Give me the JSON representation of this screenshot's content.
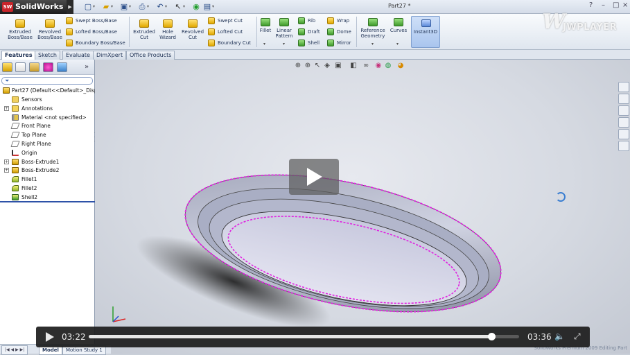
{
  "titlebar": {
    "app_name": "SolidWorks",
    "logo_mark": "SW",
    "document_title": "Part27 *",
    "quick_access_icons": [
      "new-icon",
      "open-icon",
      "save-icon",
      "print-icon",
      "undo-icon",
      "select-icon",
      "rebuild-icon",
      "options-icon"
    ],
    "window_controls": [
      "?",
      "–",
      "□",
      "×"
    ]
  },
  "watermark": {
    "mark": "W",
    "text": "JWPLAYER"
  },
  "ribbon": {
    "extruded_boss": "Extruded\nBoss/Base",
    "revolved_boss": "Revolved\nBoss/Base",
    "swept_boss": "Swept Boss/Base",
    "lofted_boss": "Lofted Boss/Base",
    "boundary_boss": "Boundary Boss/Base",
    "extruded_cut": "Extruded\nCut",
    "hole_wizard": "Hole\nWizard",
    "revolved_cut": "Revolved\nCut",
    "swept_cut": "Swept Cut",
    "lofted_cut": "Lofted Cut",
    "boundary_cut": "Boundary Cut",
    "fillet": "Fillet",
    "linear_pattern": "Linear\nPattern",
    "rib": "Rib",
    "draft": "Draft",
    "shell": "Shell",
    "wrap": "Wrap",
    "dome": "Dome",
    "mirror": "Mirror",
    "reference_geometry": "Reference\nGeometry",
    "curves": "Curves",
    "instant3d": "Instant3D"
  },
  "tabs": [
    "Features",
    "Sketch",
    "Evaluate",
    "DimXpert",
    "Office Products"
  ],
  "feature_tree": {
    "root": "Part27  (Default<<Default>_Displ",
    "items": [
      {
        "label": "Sensors",
        "icon": "sensor",
        "expandable": false
      },
      {
        "label": "Annotations",
        "icon": "anno",
        "expandable": true
      },
      {
        "label": "Material <not specified>",
        "icon": "mat",
        "expandable": false
      },
      {
        "label": "Front Plane",
        "icon": "plane",
        "expandable": false
      },
      {
        "label": "Top Plane",
        "icon": "plane",
        "expandable": false
      },
      {
        "label": "Right Plane",
        "icon": "plane",
        "expandable": false
      },
      {
        "label": "Origin",
        "icon": "origin",
        "expandable": false
      },
      {
        "label": "Boss-Extrude1",
        "icon": "feat",
        "expandable": true
      },
      {
        "label": "Boss-Extrude2",
        "icon": "feat",
        "expandable": true
      },
      {
        "label": "Fillet1",
        "icon": "fillet",
        "expandable": false
      },
      {
        "label": "Fillet2",
        "icon": "fillet",
        "expandable": false
      },
      {
        "label": "Shell2",
        "icon": "shell",
        "expandable": false
      }
    ]
  },
  "fm_expand_glyph": "»",
  "bottom_tabs": [
    "Model",
    "Motion Study 1"
  ],
  "status_text": "SolidWorks Premium 2009   Editing Part",
  "video": {
    "current_time": "03:22",
    "duration": "03:36",
    "progress": 0.935
  },
  "colors": {
    "selection_edge": "#e020e0",
    "part_body": "#b8bccf",
    "accent": "#3a66b0"
  }
}
